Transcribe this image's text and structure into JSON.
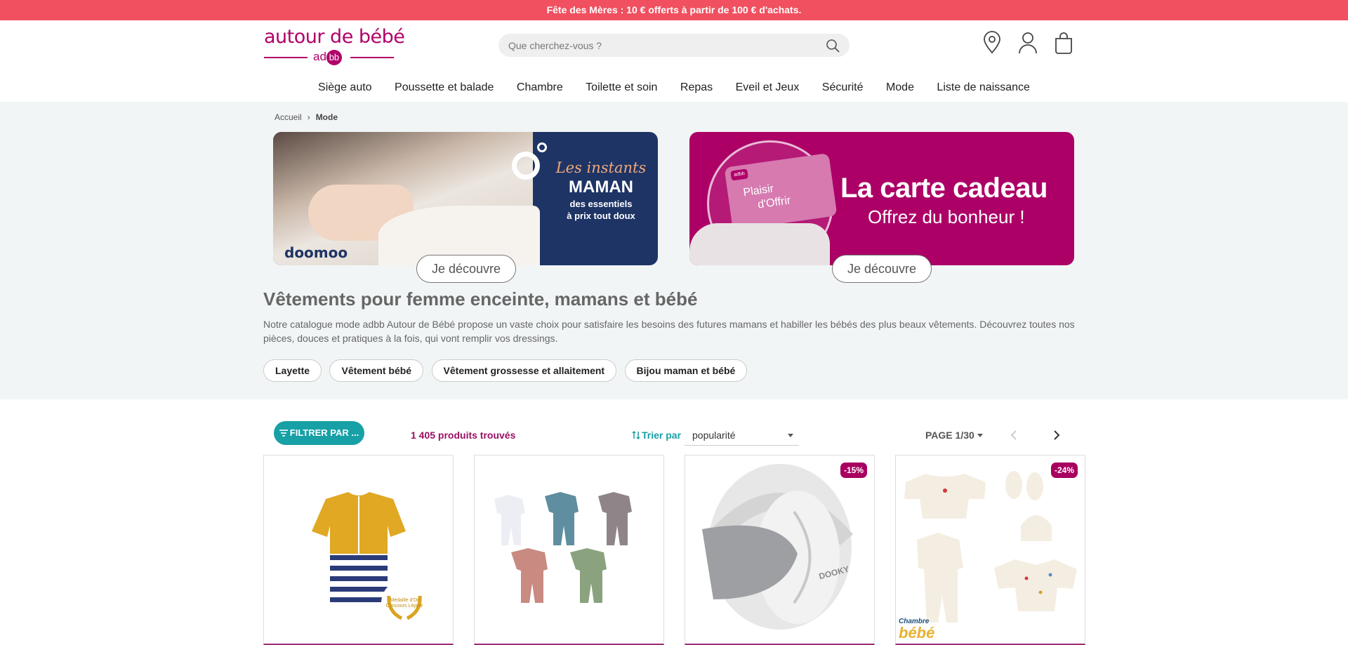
{
  "promo": {
    "text": "Fête des Mères : 10 € offerts à partir de 100 € d'achats."
  },
  "header": {
    "logo": {
      "wordmark": "autour de bébé",
      "mark": "ad",
      "mark_badge": "bb"
    },
    "search": {
      "placeholder": "Que cherchez-vous ?"
    },
    "icons": [
      "location-icon",
      "user-icon",
      "cart-icon"
    ]
  },
  "nav": {
    "items": [
      "Siège auto",
      "Poussette et balade",
      "Chambre",
      "Toilette et soin",
      "Repas",
      "Eveil et Jeux",
      "Sécurité",
      "Mode",
      "Liste de naissance"
    ]
  },
  "breadcrumb": {
    "home": "Accueil",
    "separator": "›",
    "current": "Mode"
  },
  "banners": [
    {
      "brand": "doomoo",
      "script": "Les instants",
      "headline": "MAMAN",
      "line1": "des essentiels",
      "line2": "à prix tout doux",
      "cta": "Je découvre"
    },
    {
      "card_logo": "adbb",
      "card_line1": "Plaisir",
      "card_line2": "d'Offrir",
      "headline": "La carte cadeau",
      "subline": "Offrez du bonheur !",
      "cta": "Je découvre"
    }
  ],
  "category": {
    "title": "Vêtements pour femme enceinte, mamans et bébé",
    "description": "Notre catalogue mode adbb Autour de Bébé propose un vaste choix pour satisfaire les besoins des futures mamans et habiller les bébés des plus beaux vêtements. Découvrez toutes nos pièces, douces et pratiques à la fois, qui vont remplir vos dressings.",
    "chips": [
      "Layette",
      "Vêtement bébé",
      "Vêtement grossesse et allaitement",
      "Bijou maman et bébé"
    ]
  },
  "toolbar": {
    "filter_label": "FILTRER PAR ...",
    "count": "1 405 produits trouvés",
    "sort_label": "Trier par",
    "sort_value": "popularité",
    "page_label": "PAGE 1/30"
  },
  "products": [
    {
      "badge": "",
      "medal_line1": "Médaille d'Or",
      "medal_line2": "Concours Lépine"
    },
    {
      "badge": ""
    },
    {
      "badge": "-15%",
      "brand_print": "DOOKY"
    },
    {
      "badge": "-24%",
      "corner_line1": "Chambre",
      "corner_line2": "bébé"
    }
  ],
  "colors": {
    "promo": "#f0505f",
    "brand": "#b0006a",
    "teal": "#17a0a6",
    "count": "#9a0f62",
    "navy": "#1e3465",
    "banner_pink": "#ac0067"
  }
}
